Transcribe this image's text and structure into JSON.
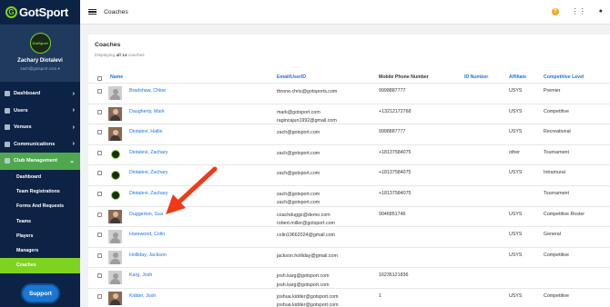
{
  "brand": {
    "name": "GotSport",
    "accent": "#7ed321",
    "sidebar_bg": "#0d2345"
  },
  "user": {
    "name": "Zachary Diotalevi",
    "email": "zach@gotsport.com",
    "avatar_text": "GotSport"
  },
  "sidebar": {
    "items": [
      {
        "label": "Dashboard",
        "icon": "dashboard-icon"
      },
      {
        "label": "Users",
        "icon": "users-icon"
      },
      {
        "label": "Venues",
        "icon": "venues-icon"
      },
      {
        "label": "Communications",
        "icon": "communications-icon"
      },
      {
        "label": "Club Management",
        "icon": "club-management-icon"
      }
    ],
    "subitems": [
      {
        "label": "Dashboard"
      },
      {
        "label": "Team Registrations"
      },
      {
        "label": "Forms And Requests"
      },
      {
        "label": "Teams"
      },
      {
        "label": "Players"
      },
      {
        "label": "Managers"
      },
      {
        "label": "Coaches"
      }
    ],
    "support_label": "Support"
  },
  "topbar": {
    "title": "Coaches",
    "help_glyph": "?"
  },
  "panel": {
    "title": "Coaches",
    "subtitle_prefix": "Displaying",
    "subtitle_all": "all 14",
    "subtitle_suffix": "coaches"
  },
  "table": {
    "headers": {
      "name": "Name",
      "email": "Email/UserID",
      "phone": "Mobile Phone Number",
      "id": "ID Number",
      "affiliate": "Affiliate",
      "level": "Competitive Level"
    },
    "rows": [
      {
        "name": "Bradshaw, Chloe",
        "email1": "throne.chris@gotsports.com",
        "email2": "",
        "phone": "9998887777",
        "affiliate": "USYS",
        "level": "Premier",
        "avatar": "placeholder"
      },
      {
        "name": "Daugherty, Mark",
        "email1": "mark@gotsport.com",
        "email2": "ragincajun1992@gmail.com",
        "phone": "+13212172768",
        "affiliate": "USYS",
        "level": "Competitive",
        "avatar": "photo"
      },
      {
        "name": "Diotalevi, Hallie",
        "email1": "zach@gotsport.com",
        "email2": "",
        "phone": "9998887777",
        "affiliate": "USYS",
        "level": "Recreational",
        "avatar": "photo"
      },
      {
        "name": "Diotalevi, Zachary",
        "email1": "zach@gotsport.com",
        "email2": "",
        "phone": "+18137584075",
        "affiliate": "other",
        "level": "Tournament",
        "avatar": "logo"
      },
      {
        "name": "Diotalevi, Zachary",
        "email1": "zach@gotsport.com",
        "email2": "",
        "phone": "+18137584075",
        "affiliate": "USYS",
        "level": "Intramural",
        "avatar": "logo"
      },
      {
        "name": "Diotalevi, Zachary",
        "email1": "zach@gotsport.com",
        "email2": "zach@gotsport.com",
        "phone": "+18137584075",
        "affiliate": "",
        "level": "Tournament",
        "avatar": "logo"
      },
      {
        "name": "Duggerton, Gus",
        "email1": "coachduggs@demo.com",
        "email2": "robert.miller@gotsport.com",
        "phone": "9046851746",
        "affiliate": "USYS",
        "level": "Competitive Roster",
        "avatar": "photo"
      },
      {
        "name": "Harewood, Colin",
        "email1": "colin19662024@gmail.com",
        "email2": "",
        "phone": "",
        "affiliate": "USYS",
        "level": "General",
        "avatar": "placeholder"
      },
      {
        "name": "Holliday, Jackson",
        "email1": "jackson.holliday@gmail.com",
        "email2": "",
        "phone": "",
        "affiliate": "USYS",
        "level": "Competitive",
        "avatar": "placeholder"
      },
      {
        "name": "Karg, Josh",
        "email1": "josh.karg@gotsport.com",
        "email2": "josh.karg@gotsport.com",
        "phone": "16235121836",
        "affiliate": "",
        "level": "",
        "avatar": "placeholder"
      },
      {
        "name": "Kidder, Josh",
        "email1": "joshua.kidder@gotsport.com",
        "email2": "joshua.kidder@gotsport.com",
        "phone": "1",
        "affiliate": "USYS",
        "level": "Competitive",
        "avatar": "photo"
      }
    ]
  },
  "annotation": {
    "arrow_color": "#f03a17"
  }
}
